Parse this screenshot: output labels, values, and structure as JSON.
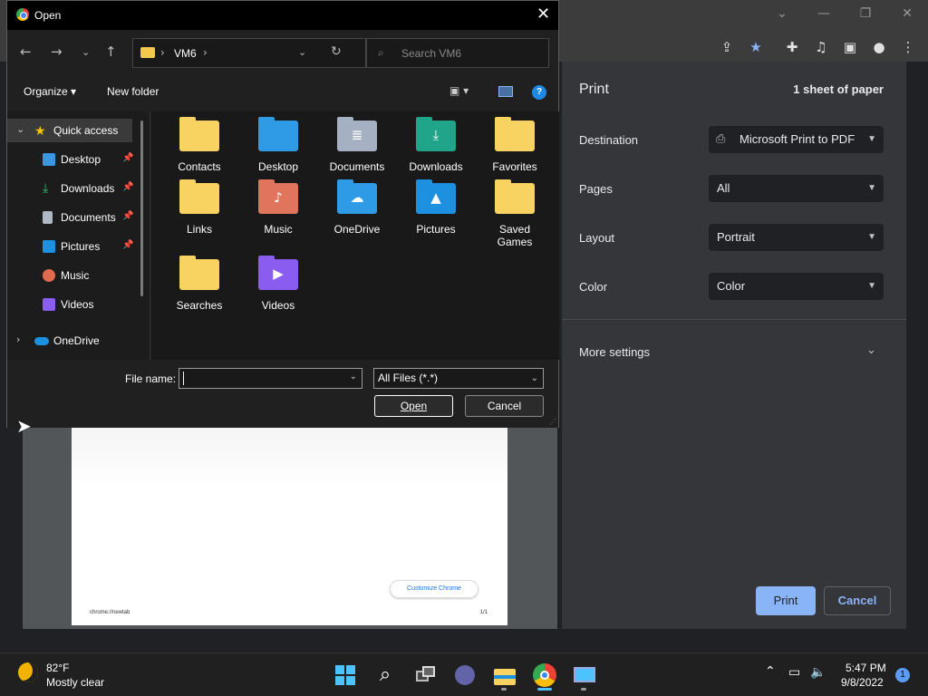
{
  "chrome": {
    "toolbar_icons": [
      "share-icon",
      "star-icon",
      "extensions-icon",
      "media-icon",
      "sidepanel-icon",
      "profile-icon",
      "menu-icon"
    ]
  },
  "preview": {
    "footer_left": "chrome://newtab",
    "footer_right": "1/1",
    "customize_label": "Customize Chrome"
  },
  "print": {
    "title": "Print",
    "sheets": "1 sheet of paper",
    "destination_label": "Destination",
    "destination_value": "Microsoft Print to PDF",
    "pages_label": "Pages",
    "pages_value": "All",
    "layout_label": "Layout",
    "layout_value": "Portrait",
    "color_label": "Color",
    "color_value": "Color",
    "more_settings": "More settings",
    "print_button": "Print",
    "cancel_button": "Cancel"
  },
  "dialog": {
    "title": "Open",
    "address": "VM6",
    "search_placeholder": "Search VM6",
    "organize": "Organize ▾",
    "new_folder": "New folder",
    "sidebar": [
      {
        "label": "Quick access"
      },
      {
        "label": "Desktop"
      },
      {
        "label": "Downloads"
      },
      {
        "label": "Documents"
      },
      {
        "label": "Pictures"
      },
      {
        "label": "Music"
      },
      {
        "label": "Videos"
      },
      {
        "label": "OneDrive"
      }
    ],
    "items": [
      {
        "label": "Contacts"
      },
      {
        "label": "Desktop"
      },
      {
        "label": "Documents"
      },
      {
        "label": "Downloads"
      },
      {
        "label": "Favorites"
      },
      {
        "label": "Links"
      },
      {
        "label": "Music"
      },
      {
        "label": "OneDrive"
      },
      {
        "label": "Pictures"
      },
      {
        "label": "Saved Games"
      },
      {
        "label": "Searches"
      },
      {
        "label": "Videos"
      }
    ],
    "file_name_label": "File name:",
    "file_name_value": "",
    "file_type": "All Files (*.*)",
    "open_button": "Open",
    "cancel_button": "Cancel"
  },
  "taskbar": {
    "temperature": "82°F",
    "weather": "Mostly clear",
    "time": "5:47 PM",
    "date": "9/8/2022",
    "notifications": "1"
  }
}
